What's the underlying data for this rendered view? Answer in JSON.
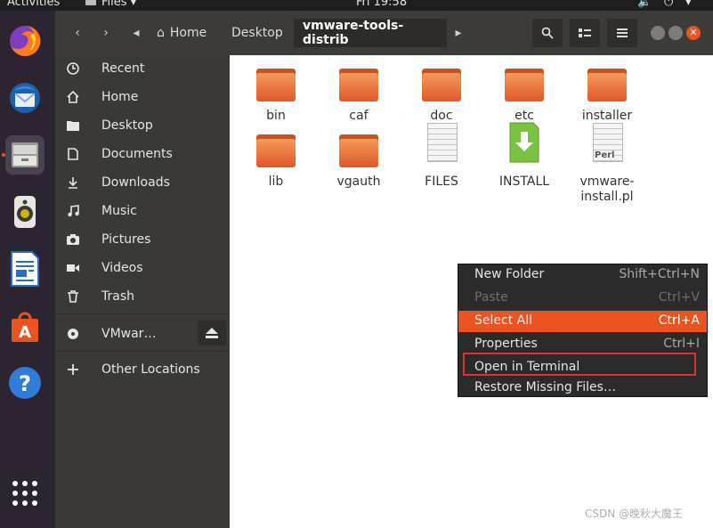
{
  "topbar": {
    "activities": "Activities",
    "app_menu": "Files",
    "clock": "Fri 19:58"
  },
  "dock": {
    "items": [
      {
        "name": "firefox"
      },
      {
        "name": "thunderbird"
      },
      {
        "name": "files",
        "active": true
      },
      {
        "name": "rhythmbox"
      },
      {
        "name": "libreoffice-writer"
      },
      {
        "name": "ubuntu-software"
      },
      {
        "name": "help"
      }
    ],
    "show_apps": "show-applications"
  },
  "headerbar": {
    "breadcrumbs": [
      "Home",
      "Desktop",
      "vmware-tools-distrib"
    ]
  },
  "sidebar": {
    "items": [
      {
        "label": "Recent",
        "icon": "clock-icon"
      },
      {
        "label": "Home",
        "icon": "home-icon"
      },
      {
        "label": "Desktop",
        "icon": "folder-icon"
      },
      {
        "label": "Documents",
        "icon": "document-icon"
      },
      {
        "label": "Downloads",
        "icon": "download-icon"
      },
      {
        "label": "Music",
        "icon": "music-icon"
      },
      {
        "label": "Pictures",
        "icon": "camera-icon"
      },
      {
        "label": "Videos",
        "icon": "video-icon"
      },
      {
        "label": "Trash",
        "icon": "trash-icon"
      },
      {
        "label": "VMwar…",
        "icon": "disc-icon"
      },
      {
        "label": "Other Locations",
        "icon": "plus-icon"
      }
    ]
  },
  "files": [
    {
      "name": "bin",
      "type": "folder"
    },
    {
      "name": "caf",
      "type": "folder"
    },
    {
      "name": "doc",
      "type": "folder"
    },
    {
      "name": "etc",
      "type": "folder"
    },
    {
      "name": "installer",
      "type": "folder"
    },
    {
      "name": "lib",
      "type": "folder"
    },
    {
      "name": "vgauth",
      "type": "folder"
    },
    {
      "name": "FILES",
      "type": "text"
    },
    {
      "name": "INSTALL",
      "type": "install"
    },
    {
      "name": "vmware-install.pl",
      "name_line1": "vmware-",
      "name_line2": "install.pl",
      "type": "perl",
      "badge": "Perl"
    }
  ],
  "context_menu": {
    "items": [
      {
        "label": "New Folder",
        "shortcut": "Shift+Ctrl+N"
      },
      {
        "label": "Paste",
        "shortcut": "Ctrl+V",
        "disabled": true
      },
      {
        "label": "Select All",
        "shortcut": "Ctrl+A",
        "selected": true
      },
      {
        "label": "Properties",
        "shortcut": "Ctrl+I"
      },
      {
        "label": "Open in Terminal",
        "shortcut": ""
      },
      {
        "label": "Restore Missing Files…",
        "shortcut": ""
      }
    ]
  },
  "colors": {
    "accent": "#e95420",
    "highlight_box": "#e03030"
  },
  "watermark": "CSDN @晚秋大魔王"
}
